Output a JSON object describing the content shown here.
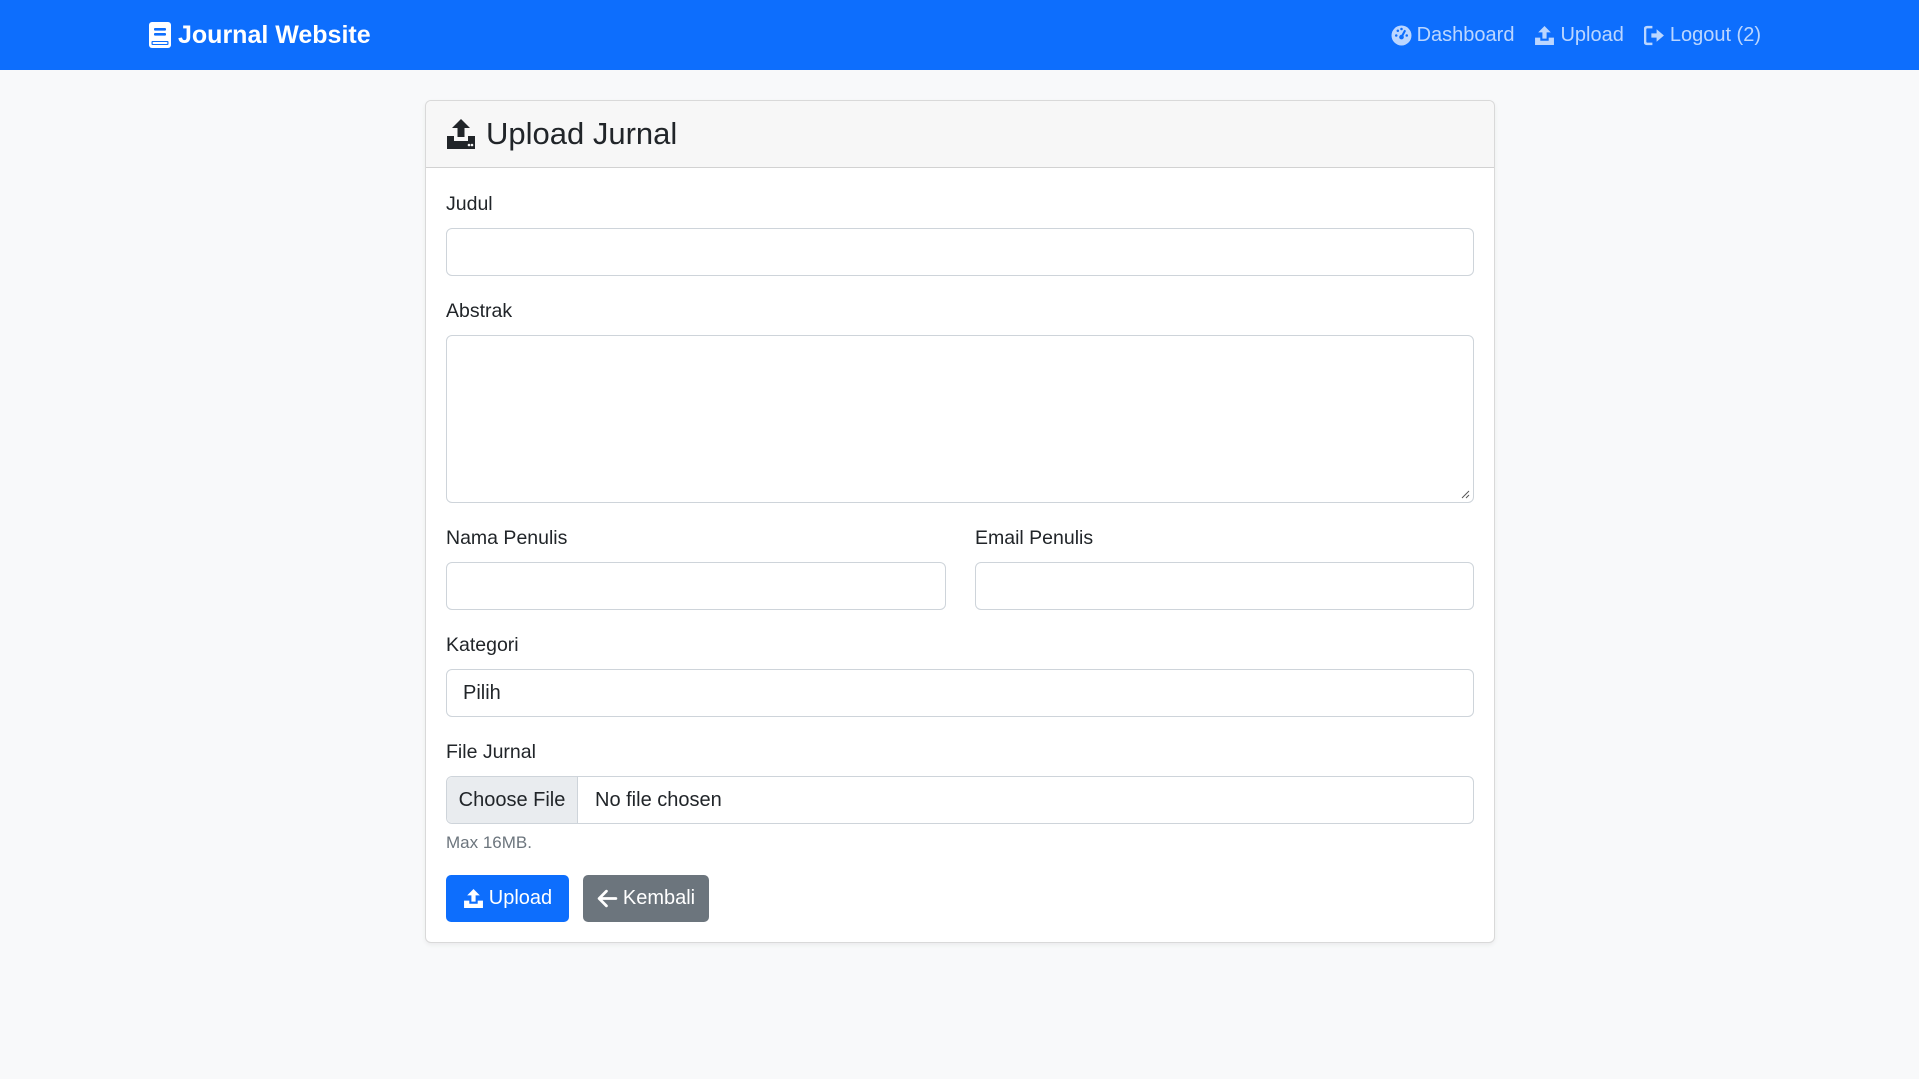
{
  "navbar": {
    "brand": "Journal Website",
    "brand_icon": "book-icon",
    "links": [
      {
        "label": "Dashboard",
        "icon": "gauge-icon"
      },
      {
        "label": "Upload",
        "icon": "upload-icon"
      },
      {
        "label": "Logout (2)",
        "icon": "logout-icon"
      }
    ]
  },
  "card": {
    "title": "Upload Jurnal",
    "icon": "upload-icon"
  },
  "form": {
    "judul_label": "Judul",
    "judul_value": "",
    "abstrak_label": "Abstrak",
    "abstrak_value": "",
    "nama_label": "Nama Penulis",
    "nama_value": "",
    "email_label": "Email Penulis",
    "email_value": "",
    "kategori_label": "Kategori",
    "kategori_selected": "Pilih",
    "file_label": "File Jurnal",
    "file_button": "Choose File",
    "file_status": "No file chosen",
    "file_help": "Max 16MB."
  },
  "actions": {
    "upload_label": "Upload",
    "back_label": "Kembali"
  },
  "colors": {
    "primary": "#0d6efd",
    "secondary": "#6c757d",
    "background": "#f8f9fa"
  }
}
